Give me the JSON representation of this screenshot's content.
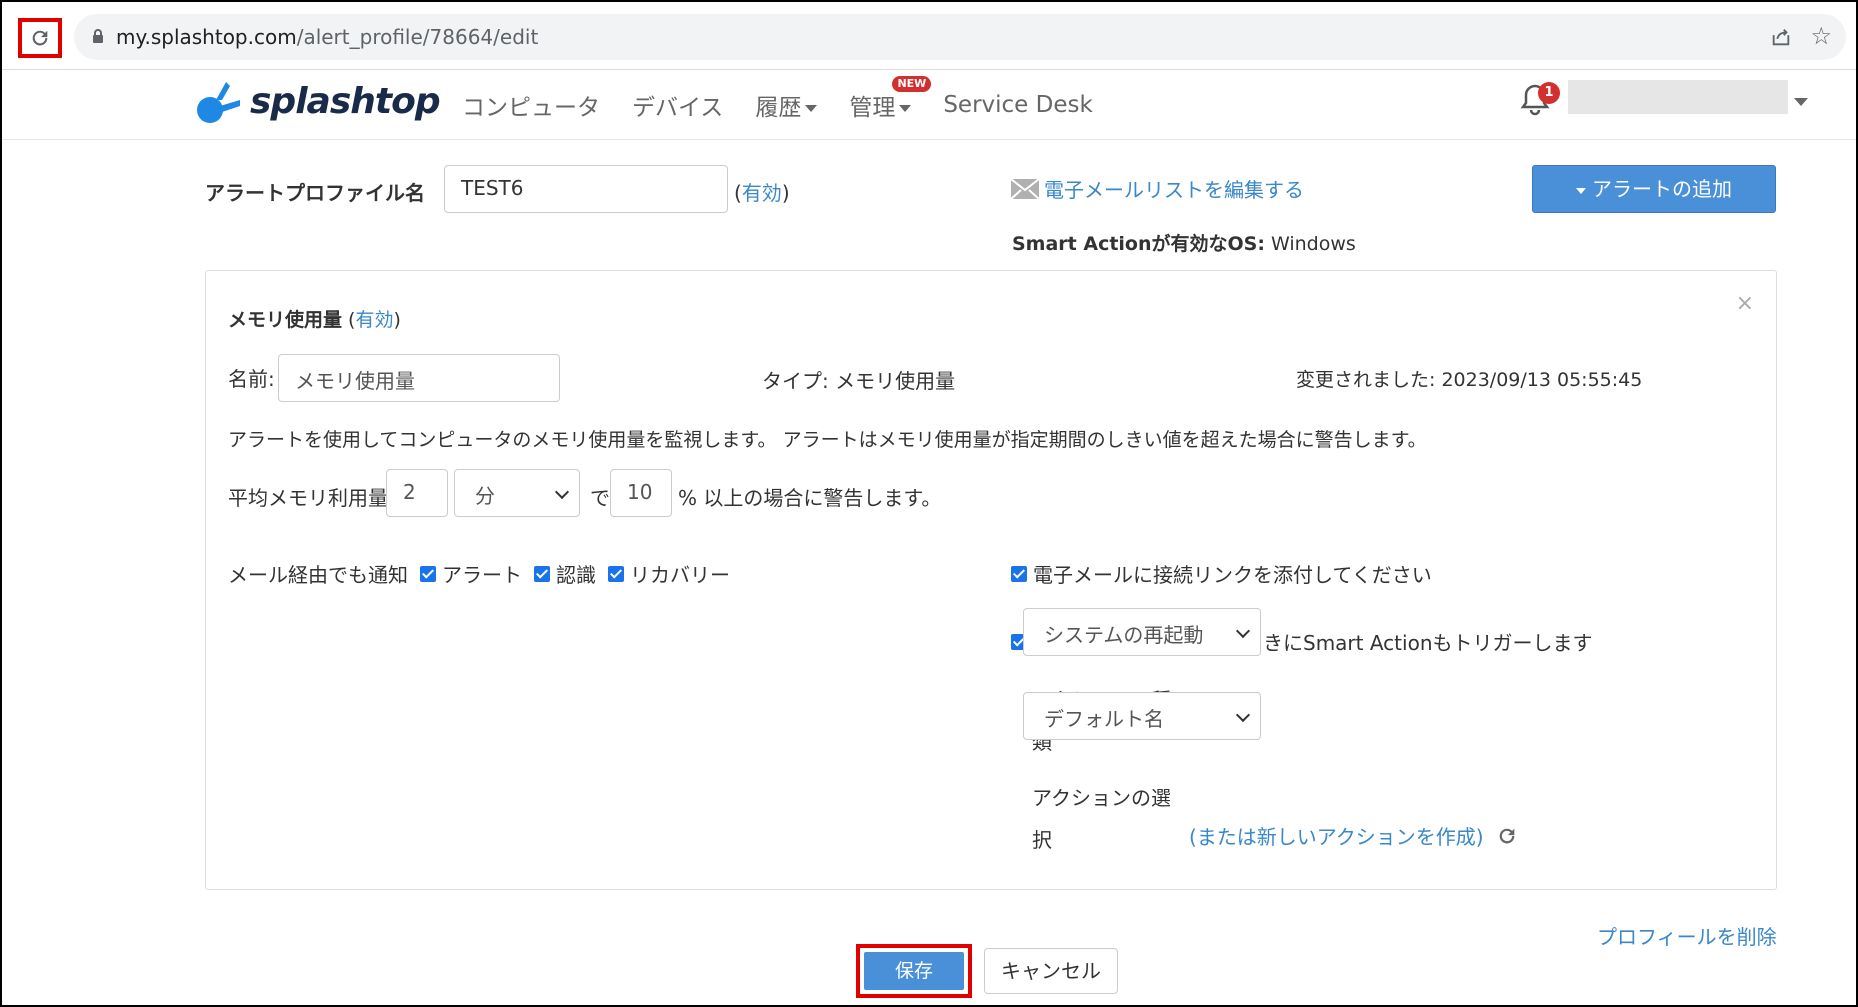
{
  "browser": {
    "url_host": "my.splashtop.com",
    "url_path": "/alert_profile/78664/edit"
  },
  "nav": {
    "logo_text": "splashtop",
    "items": [
      {
        "label": "コンピュータ"
      },
      {
        "label": "デバイス"
      },
      {
        "label": "履歴"
      },
      {
        "label": "管理",
        "badge": "NEW"
      },
      {
        "label": "Service Desk"
      }
    ],
    "notification_count": "1"
  },
  "header": {
    "profile_name_label": "アラートプロファイル名",
    "profile_name_value": "TEST6",
    "status_open": "(",
    "status_value": "有効",
    "status_close": ")",
    "edit_email_list": "電子メールリストを編集する",
    "add_alert_button": "アラートの追加",
    "smart_action_os_label": "Smart Actionが有効なOS:",
    "smart_action_os_value": " Windows"
  },
  "panel": {
    "title": "メモリ使用量",
    "title_status": "有効",
    "name_label": "名前:",
    "name_value": "メモリ使用量",
    "type_text": "タイプ: メモリ使用量",
    "modified_text": "変更されました: 2023/09/13 05:55:45",
    "description": "アラートを使用してコンピュータのメモリ使用量を監視します。 アラートはメモリ使用量が指定期間のしきい値を超えた場合に警告します。",
    "threshold": {
      "label_before": "平均メモリ利用量が",
      "duration_value": "2",
      "unit_value": "分",
      "label_mid": "で",
      "percent_value": "10",
      "label_after": "% 以上の場合に警告します。"
    },
    "notify": {
      "label": "メール経由でも通知",
      "opt_alert": "アラート",
      "opt_ack": "認識",
      "opt_recovery": "リカバリー"
    },
    "attach_link_label": "電子メールに接続リンクを添付してください",
    "trigger_label": "アラートが報告されたときにSmart Actionもトリガーします",
    "action_type_label": "アクションの種類",
    "action_type_value": "システムの再起動",
    "action_select_label": "アクションの選択",
    "action_select_value": "デフォルト名",
    "create_action_link": "(または新しいアクションを作成)"
  },
  "footer": {
    "delete_profile": "プロフィールを削除",
    "save_button": "保存",
    "cancel_button": "キャンセル"
  },
  "colors": {
    "accent": "#4a90d9",
    "link": "#3a87c9",
    "highlight_outline": "#e00000",
    "badge": "#d32f2f"
  }
}
